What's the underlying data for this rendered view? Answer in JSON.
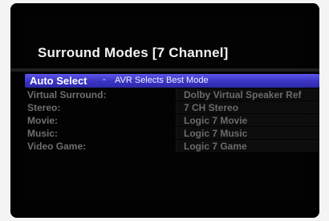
{
  "menu": {
    "title": "Surround Modes [7 Channel]",
    "selected": {
      "label": "Auto Select",
      "separator": "-",
      "description": "AVR Selects Best Mode"
    },
    "items": [
      {
        "label": "Virtual Surround:",
        "value": "Dolby Virtual Speaker Ref"
      },
      {
        "label": "Stereo:",
        "value": "7 CH Stereo"
      },
      {
        "label": "Movie:",
        "value": "Logic 7 Movie"
      },
      {
        "label": "Music:",
        "value": "Logic 7 Music"
      },
      {
        "label": "Video Game:",
        "value": "Logic 7 Game"
      }
    ]
  },
  "colors": {
    "screen_background": "#030303",
    "highlight": "#3a34c4",
    "title_text": "#f2f2f2",
    "dim_text": "#6f6f6f"
  }
}
